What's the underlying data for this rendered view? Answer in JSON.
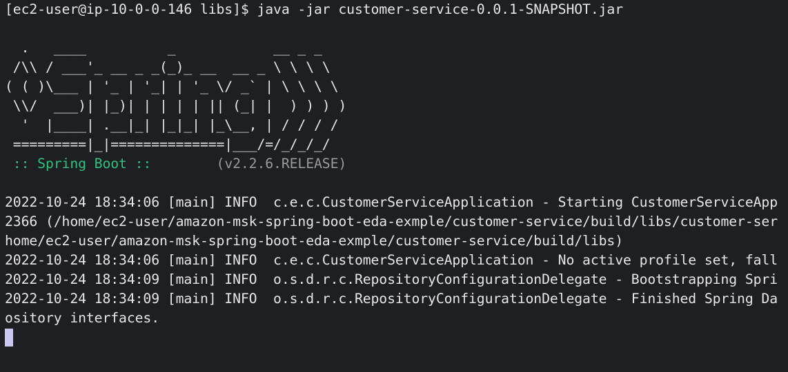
{
  "prompt_line": "[ec2-user@ip-10-0-0-146 libs]$ java -jar customer-service-0.0.1-SNAPSHOT.jar",
  "banner": [
    "  .   ____          _            __ _ _",
    " /\\\\ / ___'_ __ _ _(_)_ __  __ _ \\ \\ \\ \\",
    "( ( )\\___ | '_ | '_| | '_ \\/ _` | \\ \\ \\ \\",
    " \\\\/  ___)| |_)| | | | | || (_| |  ) ) ) )",
    "  '  |____| .__|_| |_|_| |_\\__, | / / / /",
    " =========|_|==============|___/=/_/_/_/"
  ],
  "spring_label": " :: Spring Boot :: ",
  "spring_version": "       (v2.2.6.RELEASE)",
  "log_lines": [
    "2022-10-24 18:34:06 [main] INFO  c.e.c.CustomerServiceApplication - Starting CustomerServiceApp",
    "2366 (/home/ec2-user/amazon-msk-spring-boot-eda-exmple/customer-service/build/libs/customer-ser",
    "home/ec2-user/amazon-msk-spring-boot-eda-exmple/customer-service/build/libs)",
    "2022-10-24 18:34:06 [main] INFO  c.e.c.CustomerServiceApplication - No active profile set, fall",
    "2022-10-24 18:34:09 [main] INFO  o.s.d.r.c.RepositoryConfigurationDelegate - Bootstrapping Spri",
    "2022-10-24 18:34:09 [main] INFO  o.s.d.r.c.RepositoryConfigurationDelegate - Finished Spring Da",
    "ository interfaces."
  ]
}
